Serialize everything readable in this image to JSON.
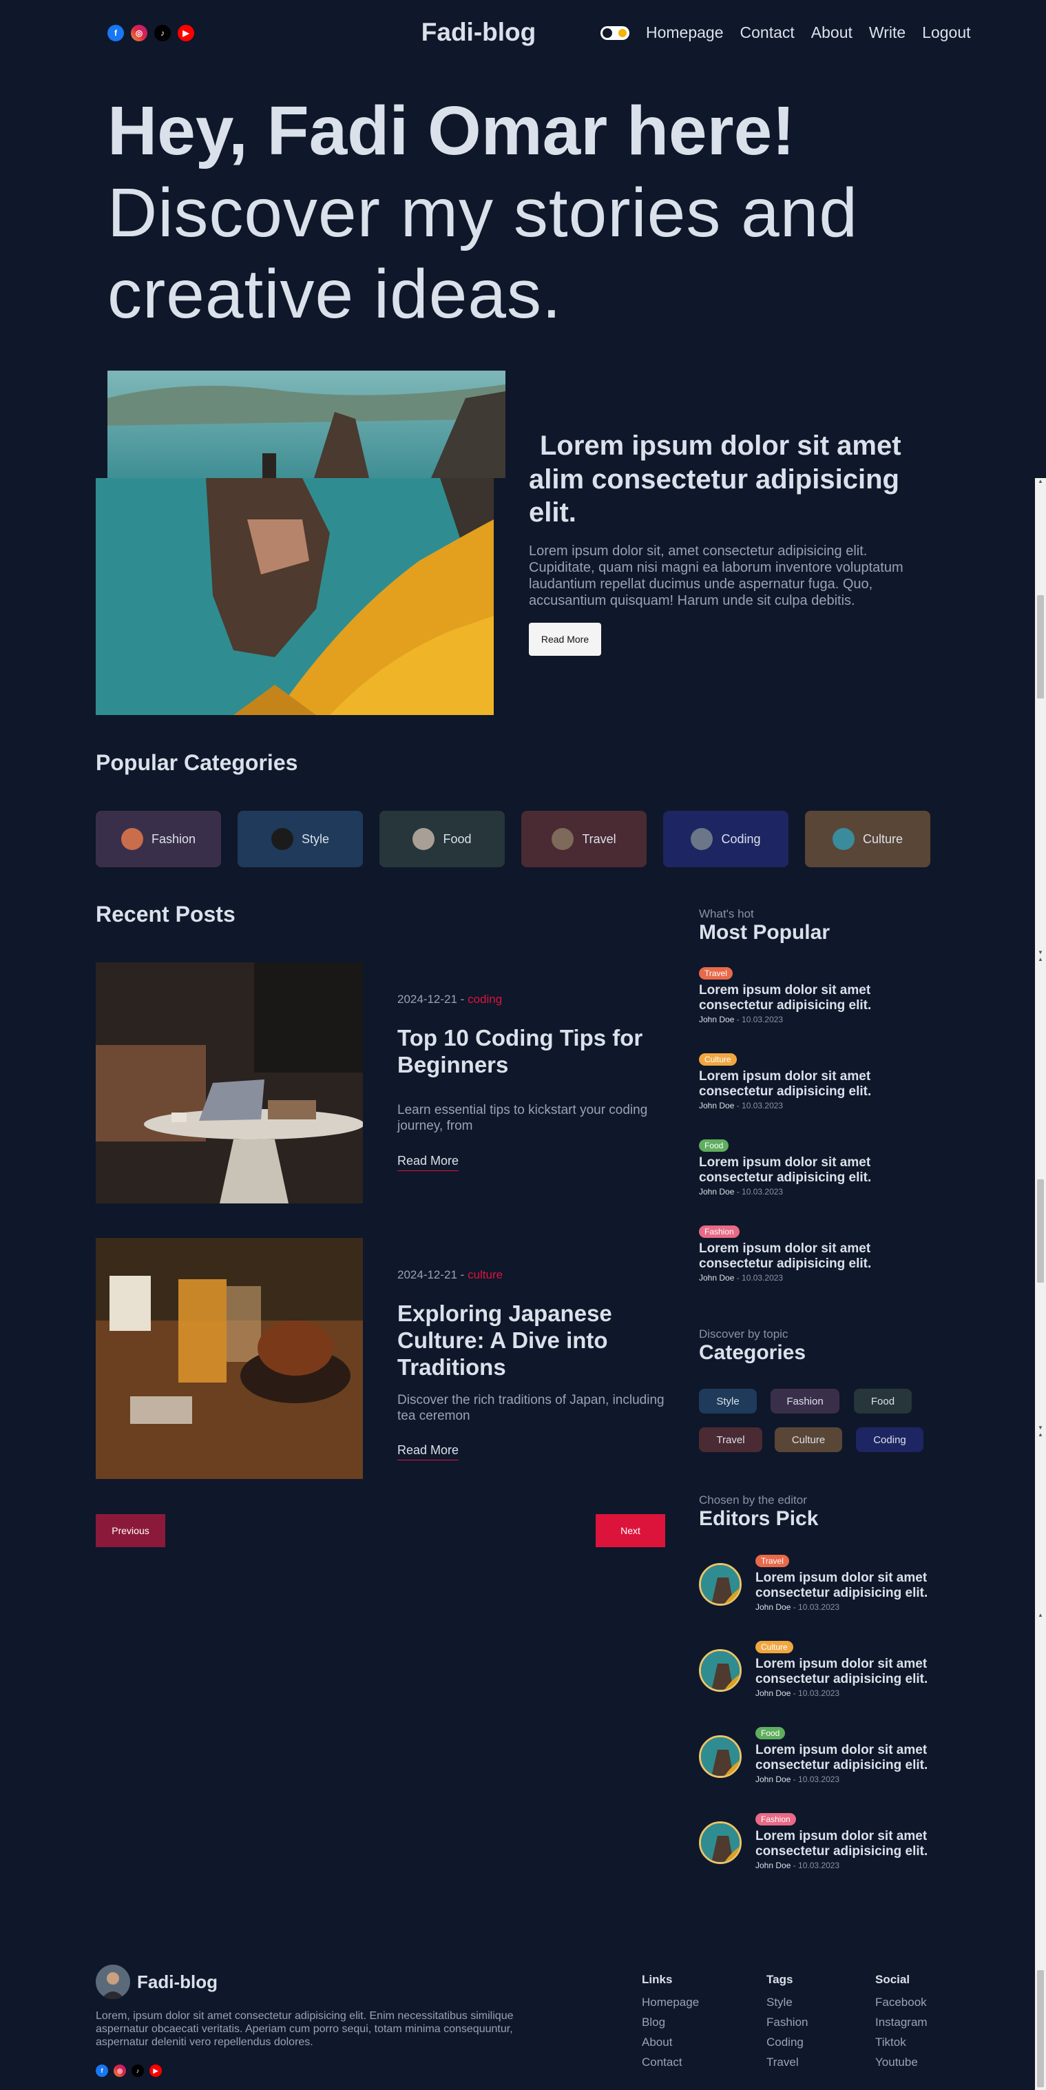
{
  "header": {
    "logo": "Fadi-blog",
    "socials": [
      {
        "icon": "facebook-icon",
        "glyph": "f"
      },
      {
        "icon": "instagram-icon",
        "glyph": "◎"
      },
      {
        "icon": "tiktok-icon",
        "glyph": "♪"
      },
      {
        "icon": "youtube-icon",
        "glyph": "▶"
      }
    ],
    "nav": [
      "Homepage",
      "Contact",
      "About",
      "Write",
      "Logout"
    ]
  },
  "hero": {
    "greeting": "Hey, Fadi Omar here!",
    "line1": "Discover my stories and",
    "line2": "creative ideas."
  },
  "featured": {
    "title_line1": "Lorem ipsum dolor sit amet",
    "title_rest": "alim consectetur adipisicing elit.",
    "description": "Lorem ipsum dolor sit, amet consectetur adipisicing elit. Cupiditate, quam nisi magni ea laborum inventore voluptatum laudantium repellat ducimus unde aspernatur fuga. Quo, accusantium quisquam! Harum unde sit culpa debitis.",
    "button": "Read More"
  },
  "popular_categories": {
    "title": "Popular Categories",
    "items": [
      {
        "label": "Fashion",
        "bg": "#3a2f4a",
        "thumb": "#c96d4a"
      },
      {
        "label": "Style",
        "bg": "#1f3a5a",
        "thumb": "#1b1b1b"
      },
      {
        "label": "Food",
        "bg": "#26363a",
        "thumb": "#a89f96"
      },
      {
        "label": "Travel",
        "bg": "#4a2a33",
        "thumb": "#7d6a5a"
      },
      {
        "label": "Coding",
        "bg": "#1e2563",
        "thumb": "#6b7788"
      },
      {
        "label": "Culture",
        "bg": "#5a4636",
        "thumb": "#3a8c9c"
      }
    ]
  },
  "recent_posts": {
    "title": "Recent Posts",
    "posts": [
      {
        "date": "2024-12-21 - ",
        "category": "coding",
        "title": "Top 10 Coding Tips for Beginners",
        "description": "Learn essential tips to kickstart your coding journey, from",
        "read_more": "Read More"
      },
      {
        "date": "2024-12-21 - ",
        "category": "culture",
        "title": "Exploring Japanese Culture: A Dive into Traditions",
        "description": "Discover the rich traditions of Japan, including tea ceremon",
        "read_more": "Read More"
      }
    ],
    "prev": "Previous",
    "next": "Next"
  },
  "most_popular": {
    "subtitle": "What's hot",
    "title": "Most Popular",
    "items": [
      {
        "badge": "Travel",
        "color": "#e86a4a",
        "title": "Lorem ipsum dolor sit amet consectetur adipisicing elit.",
        "author": "John Doe",
        "date": " - 10.03.2023"
      },
      {
        "badge": "Culture",
        "color": "#f0a740",
        "title": "Lorem ipsum dolor sit amet consectetur adipisicing elit.",
        "author": "John Doe",
        "date": " - 10.03.2023"
      },
      {
        "badge": "Food",
        "color": "#5fae5f",
        "title": "Lorem ipsum dolor sit amet consectetur adipisicing elit.",
        "author": "John Doe",
        "date": " - 10.03.2023"
      },
      {
        "badge": "Fashion",
        "color": "#e86a86",
        "title": "Lorem ipsum dolor sit amet consectetur adipisicing elit.",
        "author": "John Doe",
        "date": " - 10.03.2023"
      }
    ]
  },
  "topics": {
    "subtitle": "Discover by topic",
    "title": "Categories",
    "items": [
      {
        "label": "Style",
        "bg": "#1f3a5a"
      },
      {
        "label": "Fashion",
        "bg": "#3a2f4a"
      },
      {
        "label": "Food",
        "bg": "#26363a"
      },
      {
        "label": "Travel",
        "bg": "#4a2a33"
      },
      {
        "label": "Culture",
        "bg": "#5a4636"
      },
      {
        "label": "Coding",
        "bg": "#1e2563"
      }
    ]
  },
  "editors_pick": {
    "subtitle": "Chosen by the editor",
    "title": "Editors Pick",
    "items": [
      {
        "badge": "Travel",
        "color": "#e86a4a",
        "title": "Lorem ipsum dolor sit amet consectetur adipisicing elit.",
        "author": "John Doe",
        "date": " - 10.03.2023"
      },
      {
        "badge": "Culture",
        "color": "#f0a740",
        "title": "Lorem ipsum dolor sit amet consectetur adipisicing elit.",
        "author": "John Doe",
        "date": " - 10.03.2023"
      },
      {
        "badge": "Food",
        "color": "#5fae5f",
        "title": "Lorem ipsum dolor sit amet consectetur adipisicing elit.",
        "author": "John Doe",
        "date": " - 10.03.2023"
      },
      {
        "badge": "Fashion",
        "color": "#e86a86",
        "title": "Lorem ipsum dolor sit amet consectetur adipisicing elit.",
        "author": "John Doe",
        "date": " - 10.03.2023"
      }
    ]
  },
  "footer": {
    "logo": "Fadi-blog",
    "description": "Lorem, ipsum dolor sit amet consectetur adipisicing elit. Enim necessitatibus similique aspernatur obcaecati veritatis. Aperiam cum porro sequi, totam minima consequuntur, aspernatur deleniti vero repellendus dolores.",
    "columns": [
      {
        "heading": "Links",
        "items": [
          "Homepage",
          "Blog",
          "About",
          "Contact"
        ]
      },
      {
        "heading": "Tags",
        "items": [
          "Style",
          "Fashion",
          "Coding",
          "Travel"
        ]
      },
      {
        "heading": "Social",
        "items": [
          "Facebook",
          "Instagram",
          "Tiktok",
          "Youtube"
        ]
      }
    ]
  },
  "colors": {
    "background": "#0f172a",
    "accent": "#dc143c",
    "text": "#dbe1ea",
    "muted": "#9aa3b2"
  }
}
